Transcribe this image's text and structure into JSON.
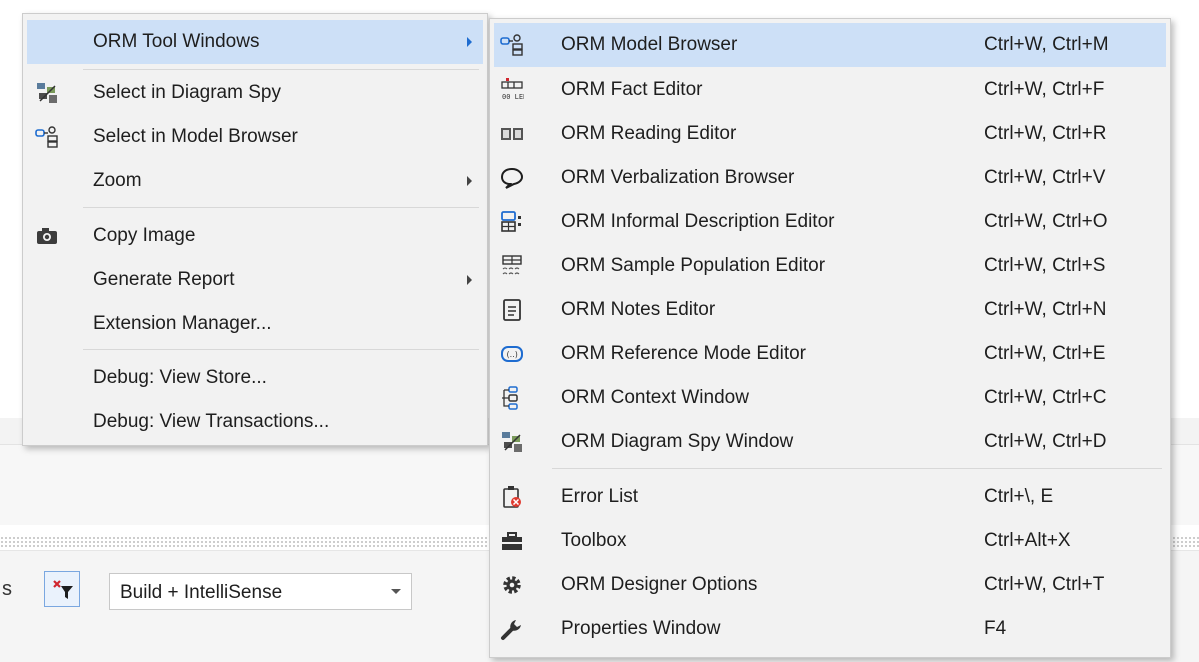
{
  "context_menu": {
    "items": [
      {
        "label": "ORM Tool Windows",
        "icon": "none",
        "submenu": true,
        "highlighted": true
      },
      {
        "label": "Select in Diagram Spy",
        "icon": "diagram-spy-icon"
      },
      {
        "label": "Select in Model Browser",
        "icon": "model-browser-icon"
      },
      {
        "label": "Zoom",
        "icon": "none",
        "submenu": true
      },
      {
        "label": "Copy Image",
        "icon": "camera-icon"
      },
      {
        "label": "Generate Report",
        "icon": "none",
        "submenu": true
      },
      {
        "label": "Extension Manager...",
        "icon": "none"
      },
      {
        "label": "Debug: View Store...",
        "icon": "none"
      },
      {
        "label": "Debug: View Transactions...",
        "icon": "none"
      }
    ]
  },
  "submenu": {
    "items": [
      {
        "label": "ORM Model Browser",
        "shortcut": "Ctrl+W, Ctrl+M",
        "icon": "model-browser-icon",
        "highlighted": true
      },
      {
        "label": "ORM Fact Editor",
        "shortcut": "Ctrl+W, Ctrl+F",
        "icon": "fact-editor-icon"
      },
      {
        "label": "ORM Reading Editor",
        "shortcut": "Ctrl+W, Ctrl+R",
        "icon": "reading-editor-icon"
      },
      {
        "label": "ORM Verbalization Browser",
        "shortcut": "Ctrl+W, Ctrl+V",
        "icon": "speech-bubble-icon"
      },
      {
        "label": "ORM Informal Description Editor",
        "shortcut": "Ctrl+W, Ctrl+O",
        "icon": "description-editor-icon"
      },
      {
        "label": "ORM Sample Population Editor",
        "shortcut": "Ctrl+W, Ctrl+S",
        "icon": "sample-population-icon"
      },
      {
        "label": "ORM Notes Editor",
        "shortcut": "Ctrl+W, Ctrl+N",
        "icon": "notes-icon"
      },
      {
        "label": "ORM Reference Mode Editor",
        "shortcut": "Ctrl+W, Ctrl+E",
        "icon": "reference-mode-icon"
      },
      {
        "label": "ORM Context Window",
        "shortcut": "Ctrl+W, Ctrl+C",
        "icon": "context-window-icon"
      },
      {
        "label": "ORM Diagram Spy Window",
        "shortcut": "Ctrl+W, Ctrl+D",
        "icon": "diagram-spy-icon"
      },
      {
        "label": "Error List",
        "shortcut": "Ctrl+\\, E",
        "icon": "error-list-icon"
      },
      {
        "label": "Toolbox",
        "shortcut": "Ctrl+Alt+X",
        "icon": "toolbox-icon"
      },
      {
        "label": "ORM Designer Options",
        "shortcut": "Ctrl+W, Ctrl+T",
        "icon": "gear-icon"
      },
      {
        "label": "Properties Window",
        "shortcut": "F4",
        "icon": "wrench-icon"
      }
    ]
  },
  "toolbar": {
    "partial_text": "s",
    "filter_icon": "error-filter-icon",
    "build_dropdown_value": "Build + IntelliSense"
  },
  "colors": {
    "menu_bg": "#f2f2f2",
    "highlight_bg": "#cde0f7",
    "accent": "#1e6cd0"
  }
}
